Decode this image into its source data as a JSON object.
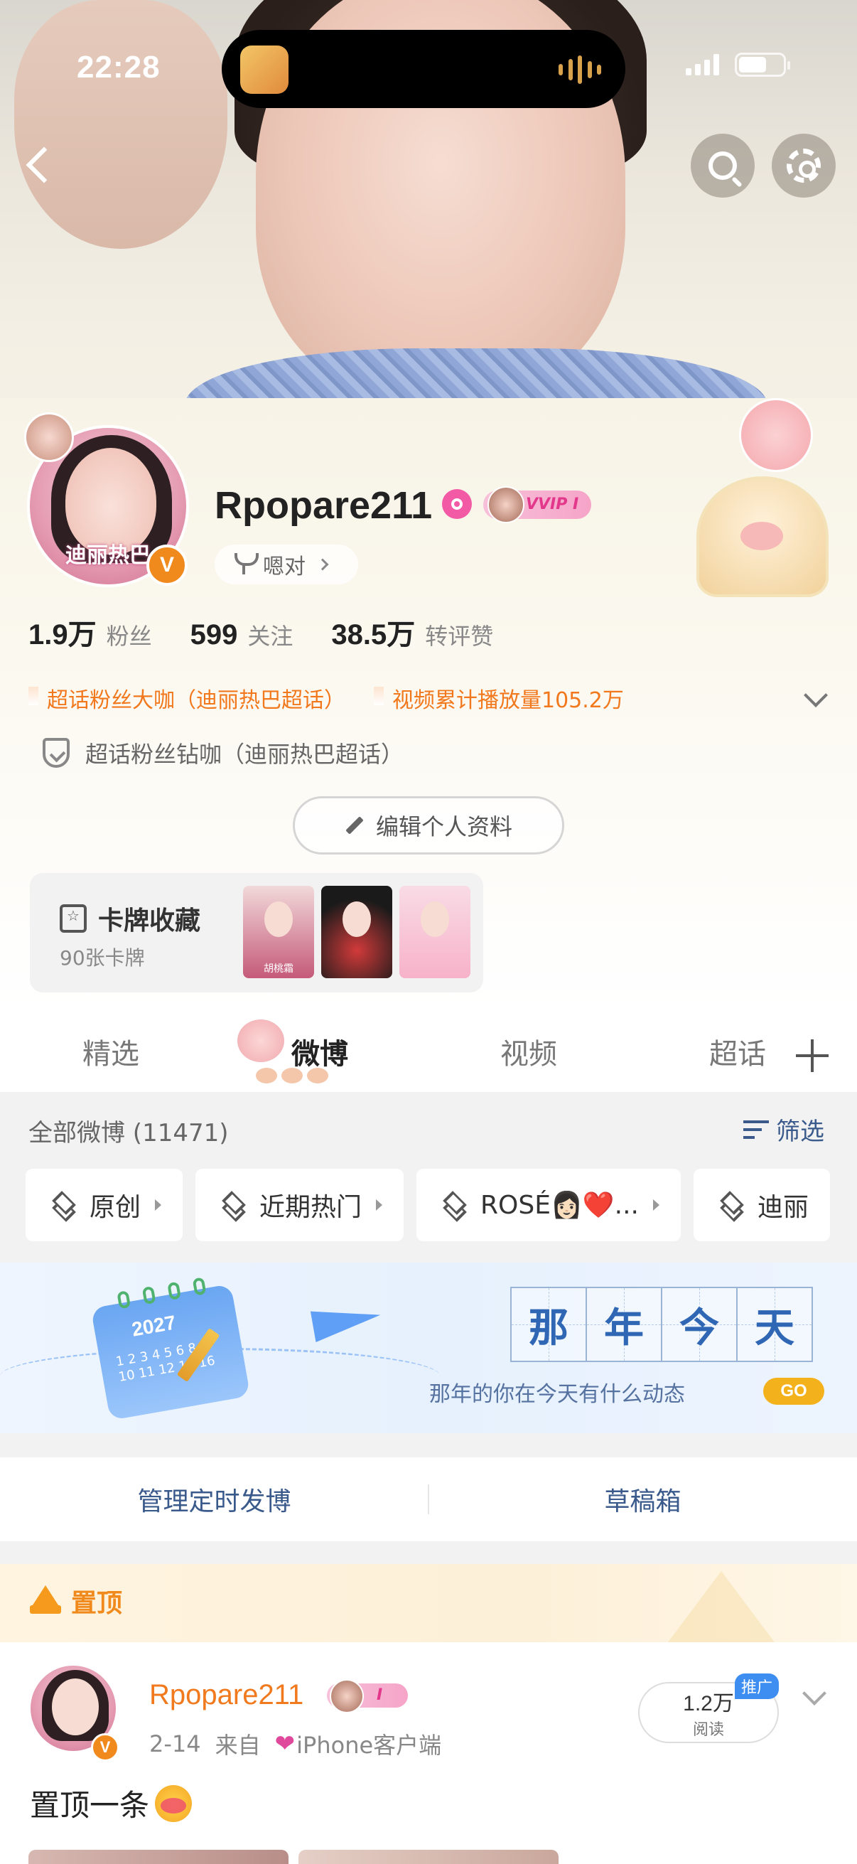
{
  "status_bar": {
    "time": "22:28"
  },
  "profile": {
    "avatar_text": "迪丽热巴",
    "verified_mark": "V",
    "username": "Rpopare211",
    "vip_label": "VVIP I",
    "title_chip": "嗯对",
    "stats": [
      {
        "num": "1.9万",
        "label": "粉丝"
      },
      {
        "num": "599",
        "label": "关注"
      },
      {
        "num": "38.5万",
        "label": "转评赞"
      }
    ],
    "honors": [
      "超话粉丝大咖（迪丽热巴超话）",
      "视频累计播放量105.2万"
    ],
    "diamond": "超话粉丝钻咖（迪丽热巴超话）",
    "edit_label": "编辑个人资料",
    "card": {
      "title": "卡牌收藏",
      "count": "90张卡牌",
      "thumb_caption": "胡桃霜"
    }
  },
  "tabs": {
    "items": [
      "精选",
      "微博",
      "视频",
      "超话"
    ],
    "active": "微博"
  },
  "filter": {
    "all_count": "全部微博 (11471)",
    "filter_label": "筛选",
    "chips": [
      "原创",
      "近期热门",
      "ROSÉ👩🏻❤️...",
      "迪丽"
    ]
  },
  "banner": {
    "calendar_year": "2027",
    "calendar_days": "1 2 3 4 5 6 8 9 10 11 12 15 16",
    "title_chars": [
      "那",
      "年",
      "今",
      "天"
    ],
    "subtitle": "那年的你在今天有什么动态",
    "go": "GO"
  },
  "manage": {
    "left": "管理定时发博",
    "right": "草稿箱"
  },
  "pinned": {
    "label": "置顶",
    "post": {
      "name": "Rpopare211",
      "vip_label": "I",
      "date": "2-14",
      "source_prefix": "来自",
      "source": "iPhone客户端",
      "reads": "1.2万",
      "reads_label": "阅读",
      "promo": "推广",
      "text": "置顶一条"
    }
  },
  "colors": {
    "accent_orange": "#f08a1d",
    "link_blue": "#3a5a8c",
    "vip_pink": "#e2378a"
  }
}
